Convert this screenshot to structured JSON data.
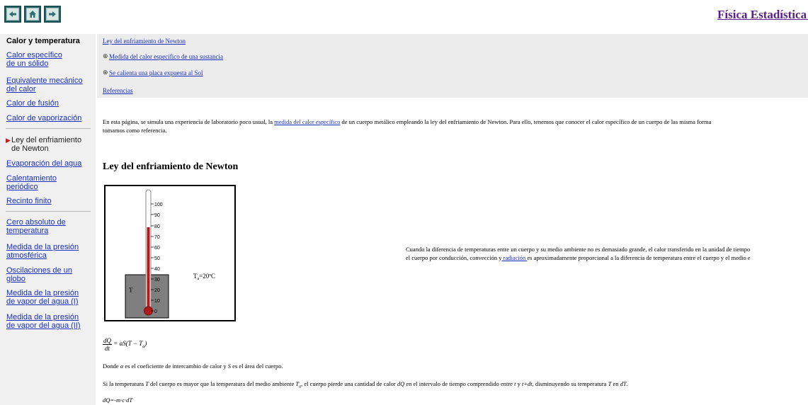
{
  "header": {
    "site_title": "Física Estadística y T",
    "buttons": [
      {
        "name": "back",
        "icon": "left-arrow-icon"
      },
      {
        "name": "home",
        "icon": "home-icon"
      },
      {
        "name": "forward",
        "icon": "right-arrow-icon"
      }
    ]
  },
  "sidebar": {
    "title": "Calor y temperatura",
    "items": [
      {
        "line1": "Calor específico",
        "line2": "de un sólido"
      },
      {
        "line1": "Equivalente mecánico",
        "line2": "del calor"
      },
      {
        "line1": "Calor de fusión"
      },
      {
        "line1": "Calor de vaporización"
      },
      {
        "line1": "Ley del enfriamiento",
        "line2": "de Newton",
        "current": true
      },
      {
        "line1": "Evaporación del agua"
      },
      {
        "line1": "Calentamiento",
        "line2": "periódico"
      },
      {
        "line1": "Recinto finito"
      },
      {
        "line1": "Cero absoluto de",
        "line2": "temperatura"
      },
      {
        "line1": "Medida de la presión",
        "line2": "atmosférica"
      },
      {
        "line1": "Oscilaciones de un",
        "line2": "globo"
      },
      {
        "line1": "Medida de la presión",
        "line2": "de vapor del agua (I)"
      },
      {
        "line1": "Medida de la presión",
        "line2": "de vapor del agua (II)"
      }
    ]
  },
  "linkbox": {
    "links": [
      "Ley del enfriamiento de Newton",
      "Medida del calor específico de una sustancia",
      "Se calienta una placa expuesta al Sol",
      "Referencias"
    ]
  },
  "intro": {
    "part1": "En esta página, se simula una experiencia de laboratorio poco usual, la ",
    "link": "medida del calor específico",
    "part2": " de un cuerpo metálico empleando la ley del enfriamiento de Newton. Para ello, tenemos que conocer el calor específico de un cuerpo de las misma forma",
    "line2": "tomamos como referencia."
  },
  "section_title": "Ley del enfriamiento de Newton",
  "figure": {
    "ticks": [
      "100",
      "90",
      "80",
      "70",
      "60",
      "50",
      "40",
      "30",
      "20",
      "10",
      "0"
    ],
    "body_label": "T",
    "ambient_label": "T",
    "ambient_sub": "a",
    "ambient_value": "=20ºC",
    "colors": {
      "mercury": "#b01a1a",
      "body": "#7f7f7f"
    }
  },
  "side_text": {
    "line1": "Cuando la diferencia de temperaturas entre un cuerpo y su medio ambiente no es demasiado grande, el calor transferido en la unidad de tiempo",
    "line2a": "el cuerpo por conducción, convección y",
    "line2link": " radiación ",
    "line2b": "es aproximadamente proporcional a la diferencia de temperatura entre el cuerpo y el medio e"
  },
  "formula": {
    "num": "dQ",
    "den": "dt",
    "rhs": "= αS(T − T",
    "sub": "a",
    "close": ")"
  },
  "para1": {
    "a": "Donde ",
    "alpha": "α",
    "b": " es el coeficiente de intercambio de calor y ",
    "S": "S",
    "c": " es el área del cuerpo."
  },
  "para2": {
    "a": "Si la temperatura ",
    "T": "T",
    "b": " del cuerpo es mayor que la temperatura del medio ambiente ",
    "Ta": "T",
    "Ta_sub": "a",
    "c": ", el cuerpo pierde una cantidad de calor ",
    "dQ": "dQ",
    "d": " en el intervalo de tiempo comprendido entre ",
    "t": "t",
    "e": " y ",
    "tdt": "t+dt",
    "f": ", disminuyendo su temperatura ",
    "T2": "T",
    "g": " en ",
    "dT": "dT",
    "h": "."
  },
  "para3": "dQ=-m·c·dT"
}
